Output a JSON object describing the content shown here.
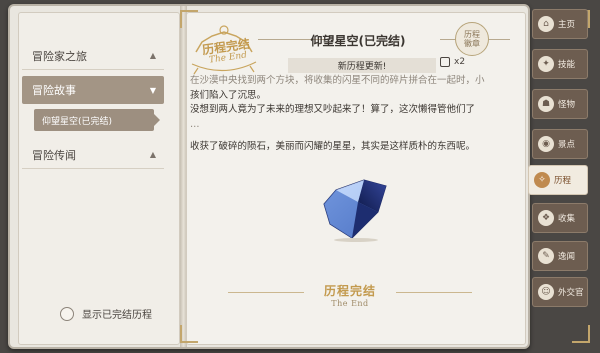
{
  "nav": {
    "items": [
      {
        "label": "冒险家之旅",
        "chevron": "▲"
      },
      {
        "label": "冒险故事",
        "chevron": "▼"
      },
      {
        "label": "冒险传闻",
        "chevron": "▲"
      }
    ],
    "sub_item": "仰望星空(已完结)"
  },
  "toggle_label": "显示已完结历程",
  "stamp": {
    "text": "历程完结",
    "sub": "The End"
  },
  "badge": {
    "line1": "历程",
    "line2": "徽章"
  },
  "title": "仰望星空(已完结)",
  "update_banner": "新历程更新!",
  "reward": {
    "count": "x2"
  },
  "story": {
    "line1": "在沙漠中央找到两个方块，将收集的闪星不同的碎片拼合在一起时，小",
    "line2": "孩们陷入了沉思。",
    "line3": "没想到两人竟为了未来的理想又吵起来了！算了，这次懒得管他们了",
    "line4": "…",
    "line5": "收获了破碎的陨石，美丽而闪耀的星星，其实是这样质朴的东西呢。"
  },
  "end": {
    "title": "历程完结",
    "sub": "The End"
  },
  "tabs": [
    {
      "label": "主页",
      "icon": "home-icon",
      "glyph": "⌂"
    },
    {
      "label": "技能",
      "icon": "skill-icon",
      "glyph": "✦"
    },
    {
      "label": "怪物",
      "icon": "monster-icon",
      "glyph": "☗"
    },
    {
      "label": "景点",
      "icon": "scenic-icon",
      "glyph": "◉"
    },
    {
      "label": "历程",
      "icon": "journey-icon",
      "glyph": "✧"
    },
    {
      "label": "收集",
      "icon": "collect-icon",
      "glyph": "❖"
    },
    {
      "label": "逸闻",
      "icon": "anecdote-icon",
      "glyph": "✎"
    },
    {
      "label": "外交官",
      "icon": "diplomat-icon",
      "glyph": "☺"
    }
  ],
  "colors": {
    "accent": "#c39a4e",
    "tab_bg": "#6d5d50",
    "active_nav": "#a39585"
  }
}
